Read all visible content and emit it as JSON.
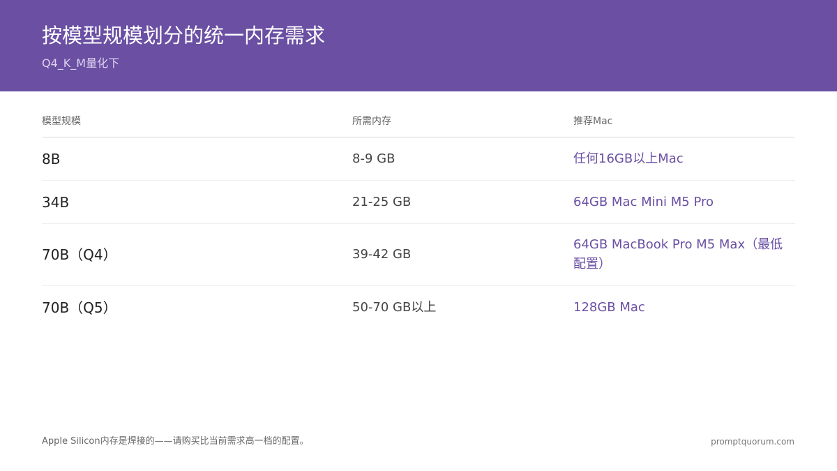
{
  "header": {
    "title": "按模型规模划分的统一内存需求",
    "subtitle": "Q4_K_M量化下"
  },
  "colors": {
    "header_bg": "#6a4fa3",
    "accent_text": "#6a4fa3"
  },
  "table": {
    "columns": [
      "模型规模",
      "所需内存",
      "推荐Mac"
    ],
    "rows": [
      {
        "size": "8B",
        "memory": "8-9 GB",
        "mac": "任何16GB以上Mac"
      },
      {
        "size": "34B",
        "memory": "21-25 GB",
        "mac": "64GB Mac Mini M5 Pro"
      },
      {
        "size": "70B（Q4）",
        "memory": "39-42 GB",
        "mac": "64GB MacBook Pro M5 Max（最低配置）"
      },
      {
        "size": "70B（Q5）",
        "memory": "50-70 GB以上",
        "mac": "128GB Mac"
      }
    ]
  },
  "footer": {
    "note": "Apple Silicon内存是焊接的——请购买比当前需求高一档的配置。",
    "site": "promptquorum.com"
  }
}
